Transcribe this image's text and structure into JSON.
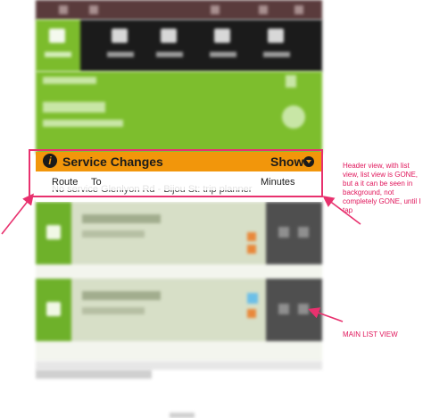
{
  "header_view": {
    "title": "Service Changes",
    "show_label": "Show",
    "notice_text": "No service Glenlyon Rd - Bijou St: trip planner"
  },
  "columns": {
    "route": "Route",
    "to": "To",
    "minutes": "Minutes"
  },
  "annotations": {
    "header_note": "Header view, with list view, list view is GONE, but a it can be seen in background, not completely GONE, until I tap",
    "list_note": "MAIN LIST VIEW"
  },
  "colors": {
    "accent_orange": "#f2960b",
    "accent_green": "#7dbe2d",
    "annotation_pink": "#e8316e"
  },
  "icons": {
    "info": "info-icon",
    "expand": "chevron-down-circle-icon"
  }
}
